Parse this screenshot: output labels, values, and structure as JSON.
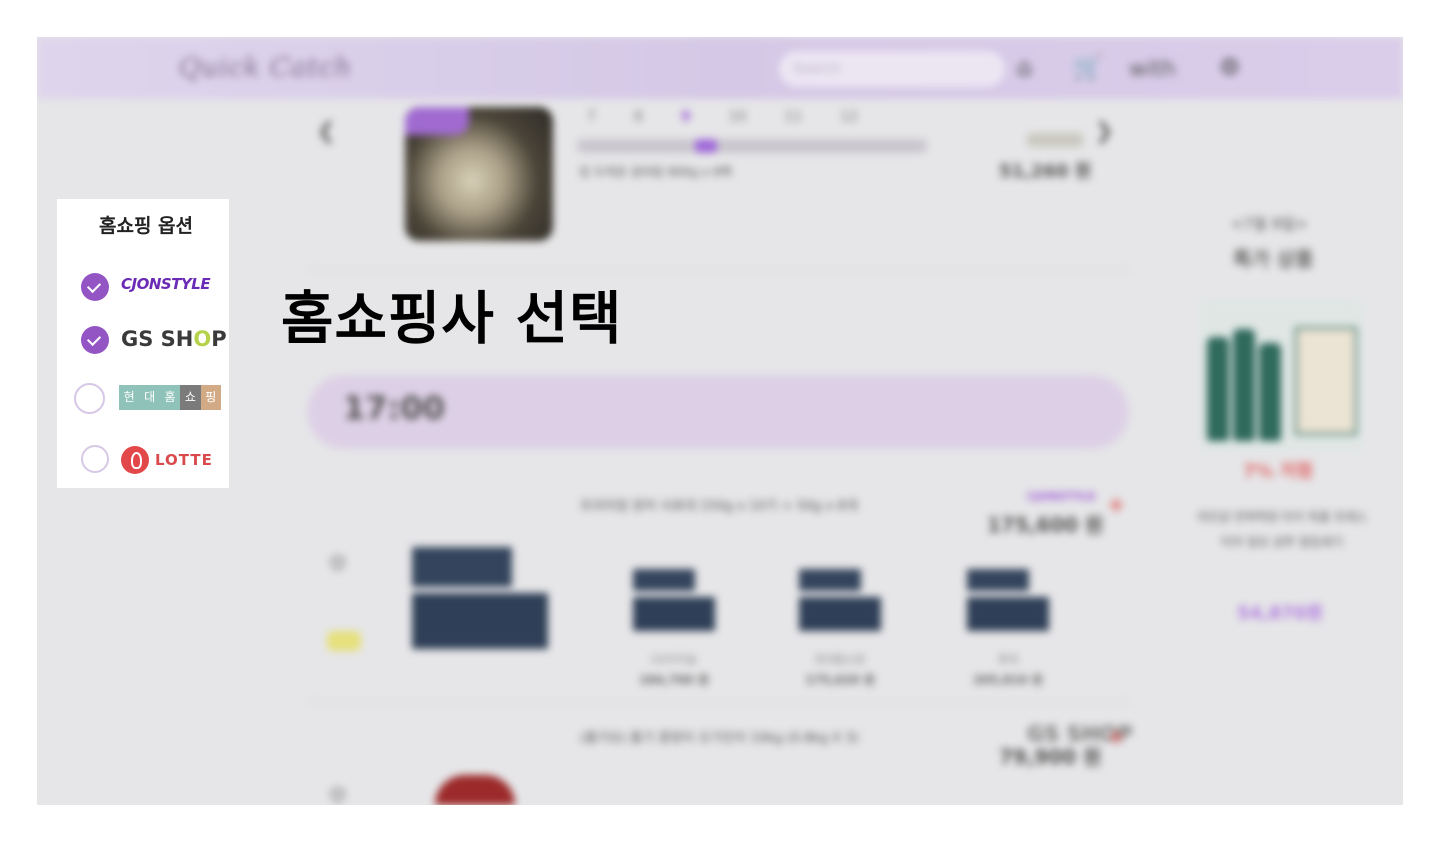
{
  "header": {
    "logo_text": "Quick Catch",
    "search_placeholder": "Search",
    "with_label": "with"
  },
  "carousel": {
    "dates": [
      "7",
      "8",
      "9",
      "10",
      "11",
      "12"
    ],
    "active_index": 2,
    "product_line": "징 두꺼운 갈비탕 800g x 8팩",
    "price": "51,260 원"
  },
  "time_slot": "17:00",
  "products": [
    {
      "title": "프리미엄 장어 사료대 150g x 10기 + 50g x 8개",
      "brand_tag": "CJONSTYLE",
      "price": "175,600 원",
      "variants": [
        {
          "label": "GS아이숍",
          "price": "184,700 원"
        },
        {
          "label": "현대홈쇼핑",
          "price": "175,620 원"
        },
        {
          "label": "롯데",
          "price": "205,810 원"
        }
      ]
    },
    {
      "title": "(홈가요) 홈기 콩양이 오기인이 10kg (0.8kg X 3)",
      "brand_tag": "GS SHOP",
      "price": "79,900 원"
    }
  ],
  "side": {
    "date": "<7월 9일>",
    "title": "특가 상품",
    "discount": "7% 저렴",
    "desc": "라인샵 전략학원 타이 독플 프레스터어 일모 샴푸 일입세기",
    "price": "54,870원"
  },
  "option_panel": {
    "title": "홈쇼핑 옵션",
    "options": [
      {
        "brand": "CJONSTYLE",
        "checked": true
      },
      {
        "brand": "GS SHOP",
        "checked": true
      },
      {
        "brand": "현대홈쇼핑",
        "chars": [
          "현",
          "대",
          "홈",
          "쇼",
          "핑"
        ],
        "checked": false
      },
      {
        "brand": "LOTTE",
        "checked": false
      }
    ]
  },
  "overlay_title": "홈쇼핑사 선택",
  "colors": {
    "accent_purple": "#9355c4",
    "header_bg": "#d4c8e6",
    "timebar_bg": "#ddd0e6",
    "hd_blocks": [
      "#8fc2b8",
      "#8fc2b8",
      "#8fc2b8",
      "#7b7b7b",
      "#d2ab86"
    ]
  }
}
